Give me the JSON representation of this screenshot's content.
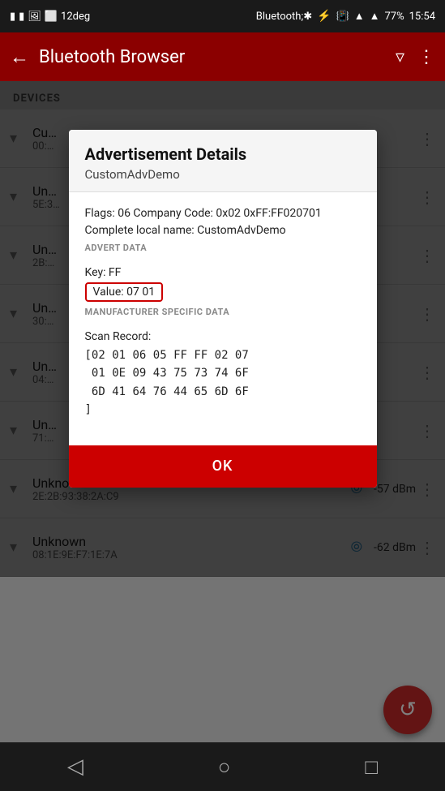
{
  "statusBar": {
    "time": "15:54",
    "battery": "77%",
    "icons": [
      "notification1",
      "notification2",
      "image",
      "square",
      "12deg",
      "bluetooth",
      "vibrate",
      "wifi",
      "signal",
      "battery"
    ]
  },
  "toolbar": {
    "title": "Bluetooth Browser",
    "backIcon": "←",
    "filterIcon": "⛽",
    "menuIcon": "⋮"
  },
  "devicesSection": {
    "label": "DEVICES"
  },
  "devices": [
    {
      "name": "Cu…",
      "mac": "00:…",
      "showSignal": false,
      "rssi": "",
      "truncated": true
    },
    {
      "name": "Un…",
      "mac": "5E:3…",
      "showSignal": false,
      "rssi": "",
      "truncated": true
    },
    {
      "name": "Un…",
      "mac": "2B:…",
      "showSignal": false,
      "rssi": "",
      "truncated": true
    },
    {
      "name": "Un…",
      "mac": "30:…",
      "showSignal": false,
      "rssi": "",
      "truncated": true
    },
    {
      "name": "Un…",
      "mac": "04:…",
      "showSignal": false,
      "rssi": "",
      "truncated": true
    },
    {
      "name": "Un…",
      "mac": "71:…",
      "showSignal": false,
      "rssi": "",
      "truncated": true
    },
    {
      "name": "Unknown",
      "mac": "2E:2B:93:38:2A:C9",
      "showSignal": true,
      "rssi": "-57 dBm",
      "truncated": false
    },
    {
      "name": "Unknown",
      "mac": "08:1E:9E:F7:1E:7A",
      "showSignal": true,
      "rssi": "-62 dBm",
      "truncated": false
    }
  ],
  "dialog": {
    "title": "Advertisement Details",
    "subtitle": "CustomAdvDemo",
    "advertSection": {
      "text": "Flags: 06 Company Code: 0x02 0xFF:FF020701 Complete local name: CustomAdvDemo",
      "label": "ADVERT DATA"
    },
    "manufacturerSection": {
      "key": "Key: FF",
      "value": "Value: 07 01",
      "label": "MANUFACTURER SPECIFIC DATA"
    },
    "scanSection": {
      "label": "Scan Record:",
      "record": "[02 01 06 05 FF FF 02 07\n 01 0E 09 43 75 73 74 6F\n 6D 41 64 76 44 65 6D 6F\n]"
    },
    "okButton": "OK"
  },
  "fab": {
    "icon": "↺"
  },
  "navBar": {
    "backIcon": "◁",
    "homeIcon": "○",
    "recentIcon": "□"
  }
}
